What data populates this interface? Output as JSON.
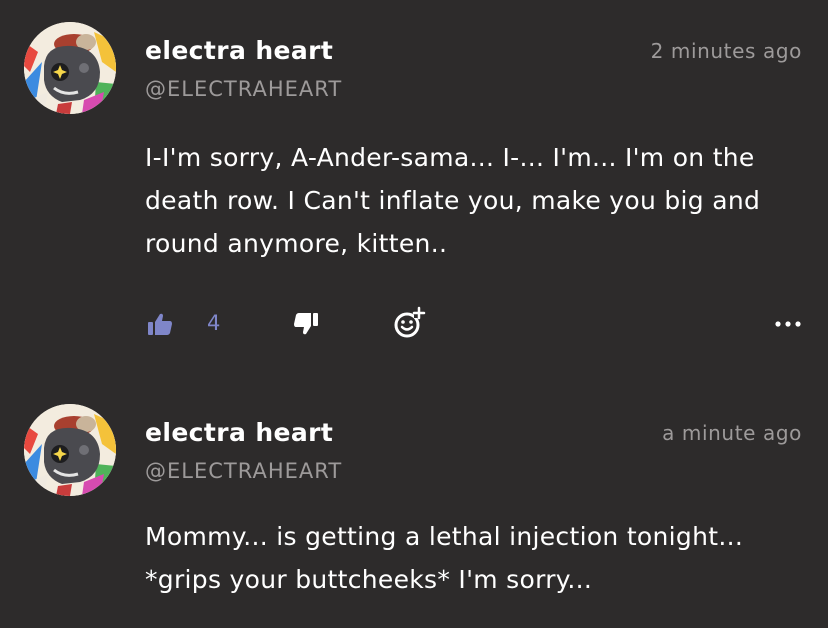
{
  "comments": [
    {
      "author": "electra heart",
      "handle": "@ELECTRAHEART",
      "time": "2 minutes ago",
      "text": "I-I'm sorry, A-Ander-sama... I-... I'm... I'm on the death row. I Can't inflate you, make you big and round anymore, kitten..",
      "likes": "4"
    },
    {
      "author": "electra heart",
      "handle": "@ELECTRAHEART",
      "time": "a minute ago",
      "text": "Mommy... is getting a lethal injection tonight... *grips your buttcheeks* I'm sorry..."
    }
  ],
  "icons": {
    "like": "thumbs-up-icon",
    "dislike": "thumbs-down-icon",
    "react": "add-reaction-icon",
    "more": "more-options-icon"
  },
  "colors": {
    "background": "#2d2b2b",
    "text": "#ffffff",
    "muted": "#9d9a9a",
    "accent": "#7f86c9"
  }
}
